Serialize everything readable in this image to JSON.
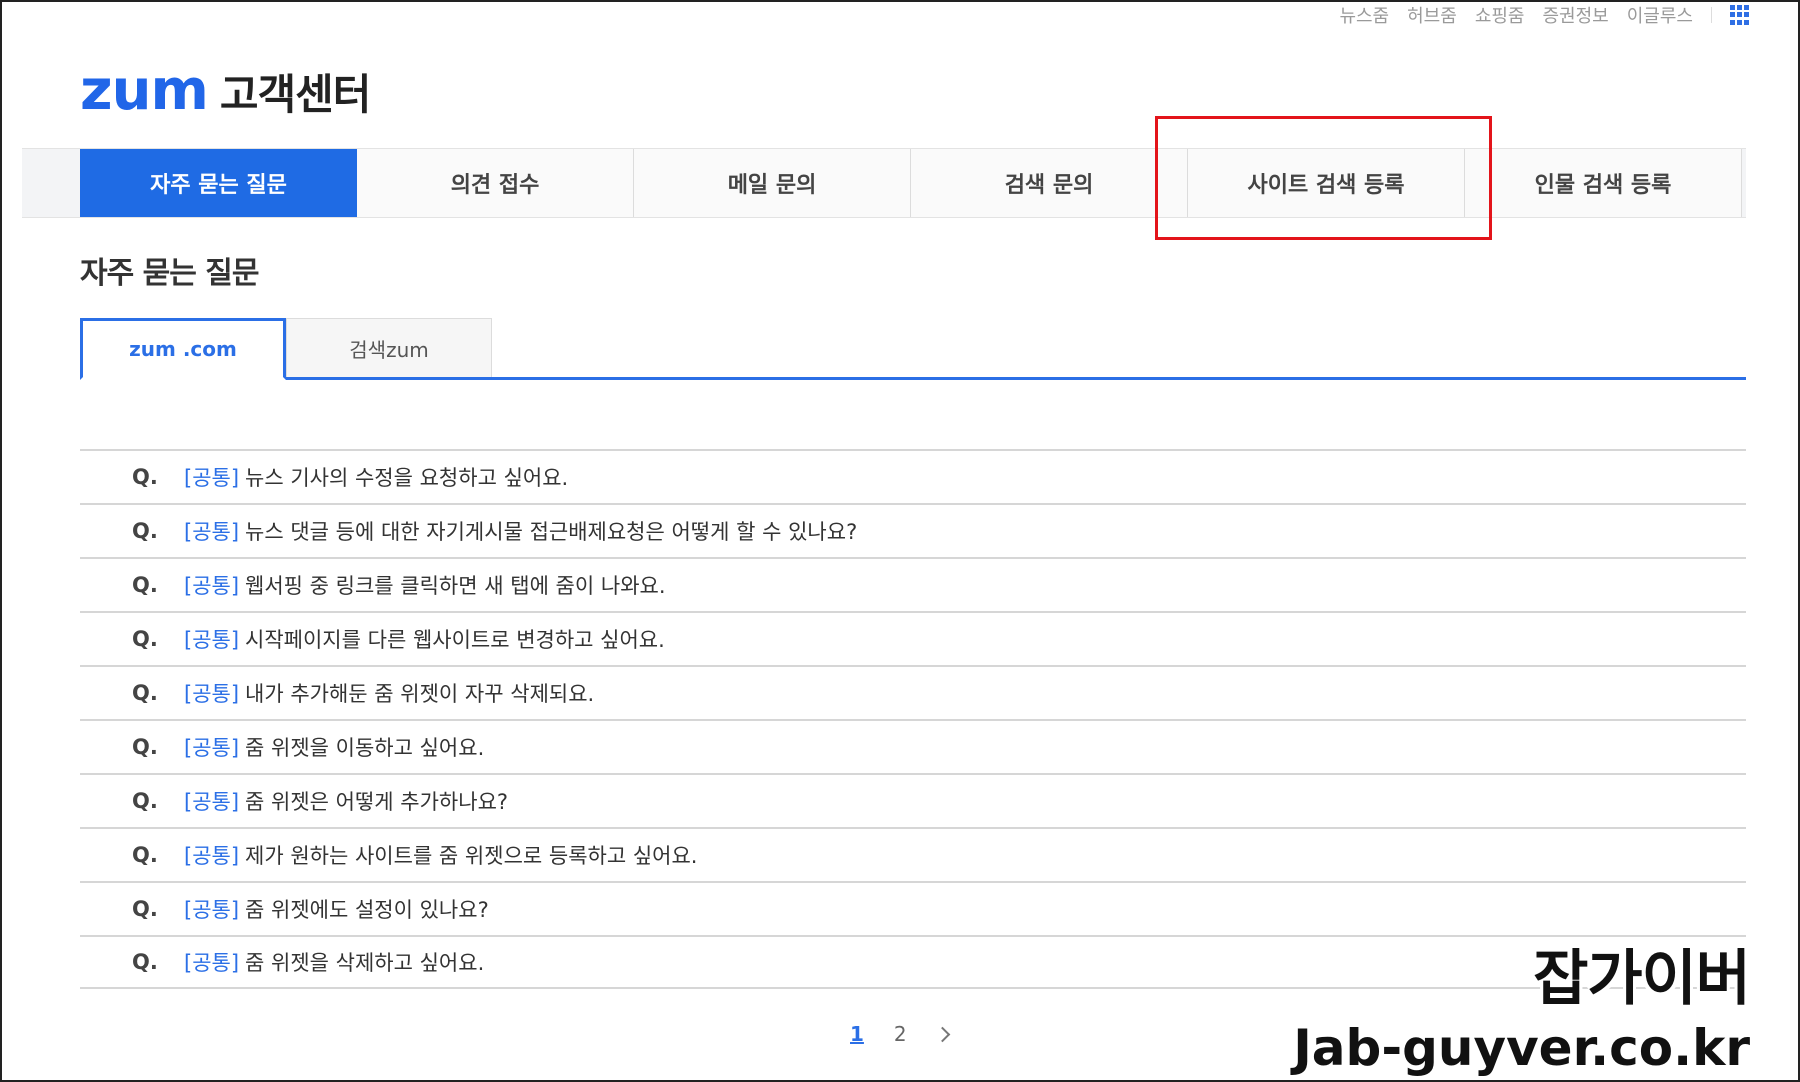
{
  "top_links": [
    "뉴스줌",
    "허브줌",
    "쇼핑줌",
    "증권정보",
    "이글루스"
  ],
  "logo": {
    "brand": "zum",
    "title": "고객센터"
  },
  "nav": {
    "tabs": [
      "자주 묻는 질문",
      "의견 접수",
      "메일 문의",
      "검색 문의",
      "사이트 검색 등록",
      "인물 검색 등록"
    ],
    "active": "자주 묻는 질문",
    "highlighted": "사이트 검색 등록",
    "highlight_color": "#e3141a"
  },
  "section_title": "자주 묻는 질문",
  "sub_tabs": [
    "zum .com",
    "검색zum"
  ],
  "faq": [
    {
      "q": "Q.",
      "category": "[공통]",
      "text": "뉴스 기사의 수정을 요청하고 싶어요."
    },
    {
      "q": "Q.",
      "category": "[공통]",
      "text": "뉴스 댓글 등에 대한 자기게시물 접근배제요청은 어떻게 할 수 있나요?"
    },
    {
      "q": "Q.",
      "category": "[공통]",
      "text": "웹서핑 중 링크를 클릭하면 새 탭에 줌이 나와요."
    },
    {
      "q": "Q.",
      "category": "[공통]",
      "text": "시작페이지를 다른 웹사이트로 변경하고 싶어요."
    },
    {
      "q": "Q.",
      "category": "[공통]",
      "text": "내가 추가해둔 줌 위젯이 자꾸 삭제되요."
    },
    {
      "q": "Q.",
      "category": "[공통]",
      "text": "줌 위젯을 이동하고 싶어요."
    },
    {
      "q": "Q.",
      "category": "[공통]",
      "text": "줌 위젯은 어떻게 추가하나요?"
    },
    {
      "q": "Q.",
      "category": "[공통]",
      "text": "제가 원하는 사이트를 줌 위젯으로 등록하고 싶어요."
    },
    {
      "q": "Q.",
      "category": "[공통]",
      "text": "줌 위젯에도 설정이 있나요?"
    },
    {
      "q": "Q.",
      "category": "[공통]",
      "text": "줌 위젯을 삭제하고 싶어요."
    }
  ],
  "pagination": {
    "pages": [
      "1",
      "2"
    ],
    "current": "1"
  },
  "watermark": {
    "title": "잡가이버",
    "url": "Jab-guyver.co.kr"
  },
  "colors": {
    "accent": "#2166e8",
    "category": "#2b6fe6"
  }
}
